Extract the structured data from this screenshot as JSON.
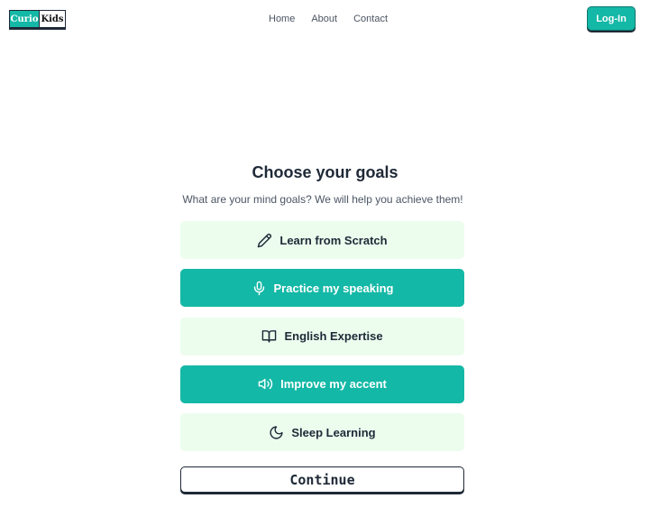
{
  "header": {
    "logo": {
      "left": "Curio",
      "right": "Kids"
    },
    "nav": [
      {
        "label": "Home"
      },
      {
        "label": "About"
      },
      {
        "label": "Contact"
      }
    ],
    "login_label": "Log-In"
  },
  "main": {
    "title": "Choose your goals",
    "subtitle": "What are your mind goals? We will help you achieve them!",
    "goals": [
      {
        "label": "Learn from Scratch",
        "icon": "pencil-icon",
        "style": "light"
      },
      {
        "label": "Practice my speaking",
        "icon": "microphone-icon",
        "style": "dark"
      },
      {
        "label": "English Expertise",
        "icon": "book-open-icon",
        "style": "light"
      },
      {
        "label": "Improve my accent",
        "icon": "speaker-icon",
        "style": "dark"
      },
      {
        "label": "Sleep Learning",
        "icon": "moon-icon",
        "style": "light"
      }
    ],
    "continue_label": "Continue"
  },
  "colors": {
    "accent": "#14b8a6",
    "light_option_bg": "#ecfdee",
    "text_dark": "#1f2937",
    "text_muted": "#4b5563"
  }
}
